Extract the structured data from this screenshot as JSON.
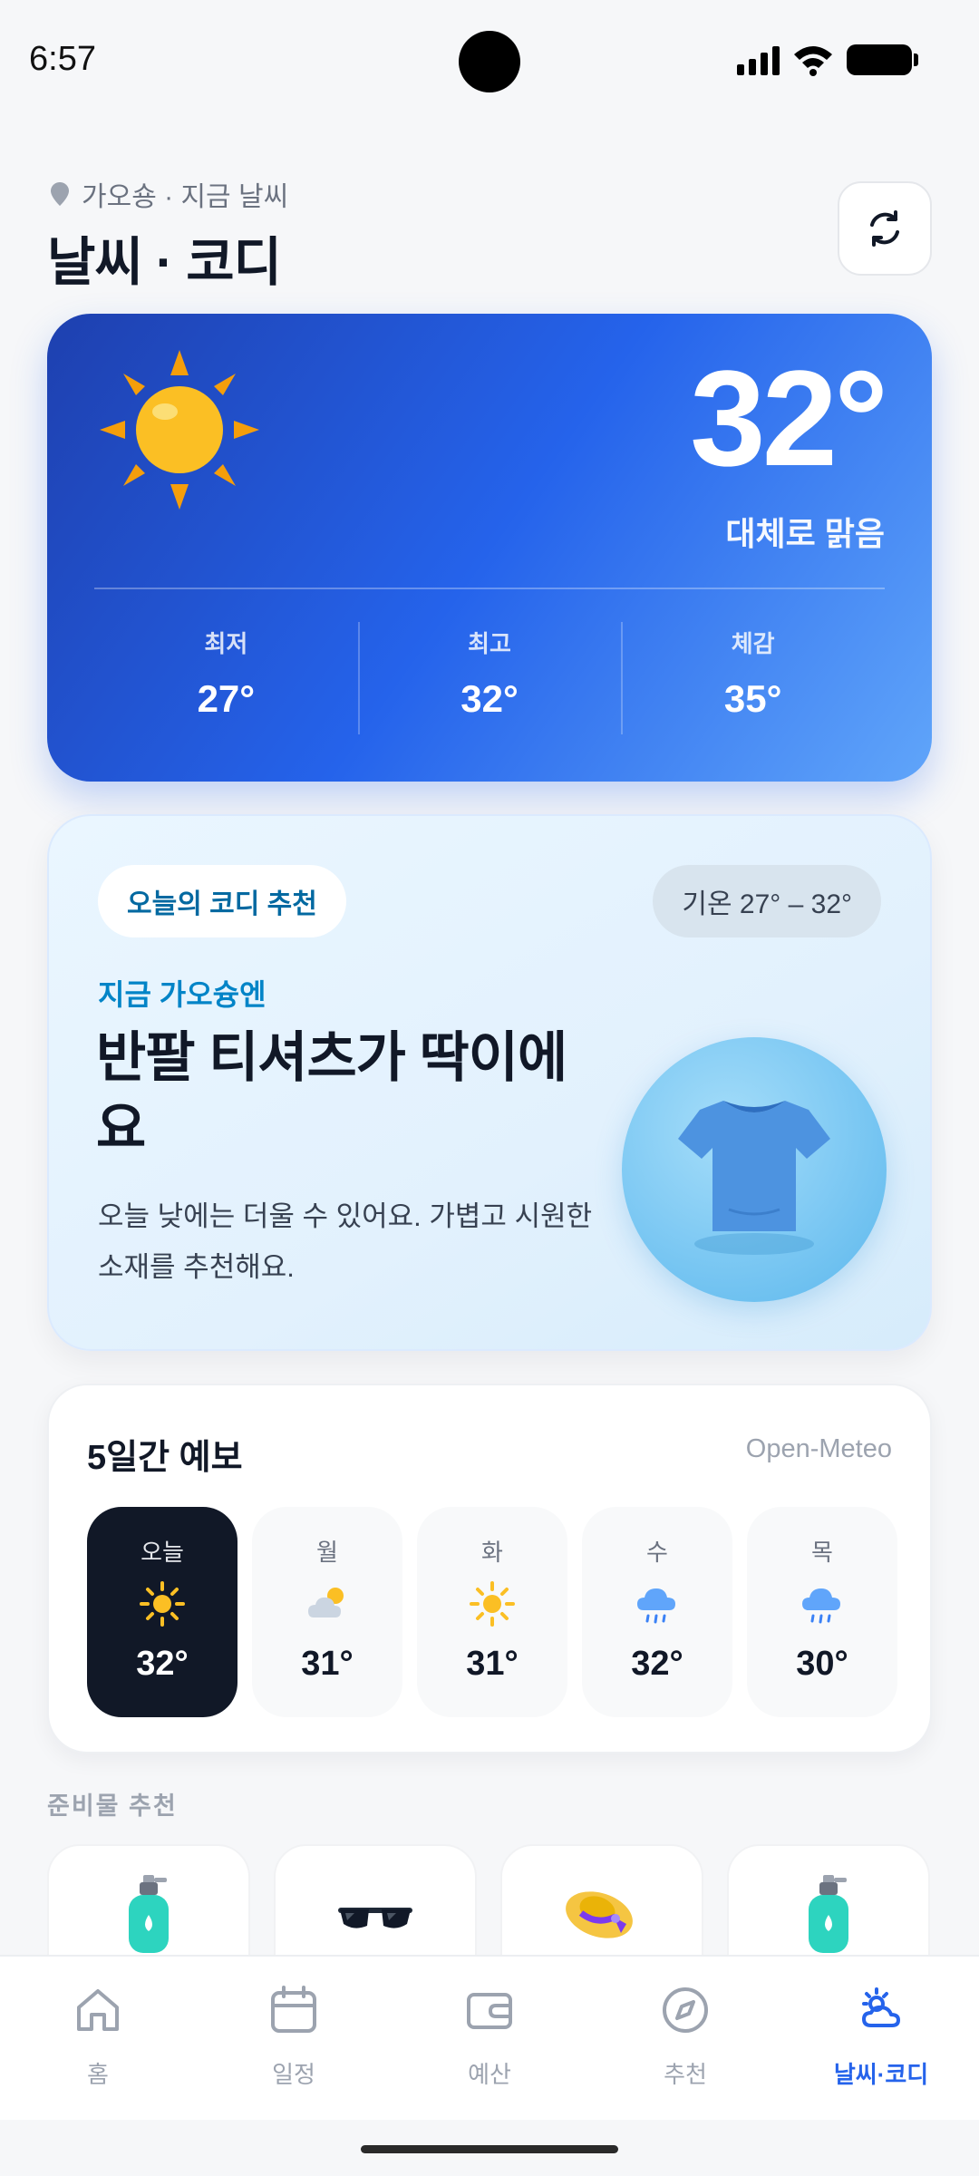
{
  "status_bar": {
    "time": "6:57"
  },
  "header": {
    "location_line": "가오숑 · 지금 날씨",
    "title": "날씨 · 코디"
  },
  "current_weather": {
    "temperature": "32°",
    "condition": "대체로 맑음",
    "icon": "sun-icon",
    "stats": [
      {
        "label": "최저",
        "value": "27°"
      },
      {
        "label": "최고",
        "value": "32°"
      },
      {
        "label": "체감",
        "value": "35°"
      }
    ]
  },
  "outfit": {
    "chip": "오늘의 코디 추천",
    "range": "기온 27° – 32°",
    "subtitle": "지금 가오슝엔",
    "title": "반팔 티셔츠가 딱이에요",
    "description": "오늘 낮에는 더울 수 있어요. 가볍고 시원한 소재를 추천해요.",
    "icon": "tshirt-icon"
  },
  "forecast": {
    "title": "5일간 예보",
    "source": "Open-Meteo",
    "days": [
      {
        "label": "오늘",
        "icon": "sun-icon",
        "temp": "32°",
        "active": true
      },
      {
        "label": "월",
        "icon": "partly-cloudy-icon",
        "temp": "31°"
      },
      {
        "label": "화",
        "icon": "sun-icon",
        "temp": "31°"
      },
      {
        "label": "수",
        "icon": "rain-icon",
        "temp": "32°"
      },
      {
        "label": "목",
        "icon": "rain-icon",
        "temp": "30°"
      }
    ]
  },
  "prep": {
    "title": "준비물 추천",
    "items": [
      {
        "icon": "lotion-bottle-icon"
      },
      {
        "icon": "sunglasses-icon"
      },
      {
        "icon": "sun-hat-icon"
      },
      {
        "icon": "lotion-bottle-icon"
      }
    ]
  },
  "nav": {
    "items": [
      {
        "label": "홈",
        "icon": "home-icon"
      },
      {
        "label": "일정",
        "icon": "calendar-icon"
      },
      {
        "label": "예산",
        "icon": "wallet-icon"
      },
      {
        "label": "추천",
        "icon": "compass-icon"
      },
      {
        "label": "날씨·코디",
        "icon": "weather-icon",
        "active": true
      }
    ]
  },
  "colors": {
    "accent": "#2563eb",
    "hero_start": "#1e40af",
    "hero_end": "#60a5fa",
    "dark_chip": "#111827",
    "sun": "#fbbf24"
  }
}
